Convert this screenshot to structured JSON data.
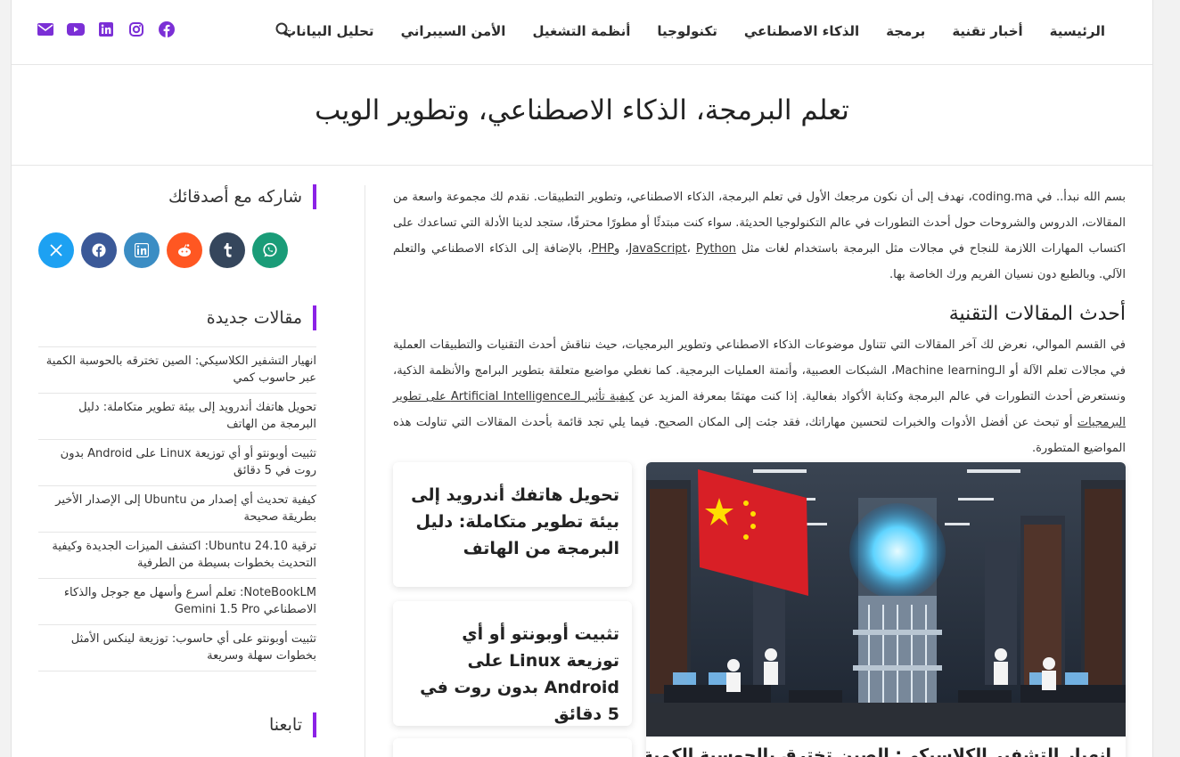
{
  "nav": {
    "items": [
      "الرئيسية",
      "أخبار تقنية",
      "برمجة",
      "الذكاء الاصطناعي",
      "تكنولوجيا",
      "أنظمة التشغيل",
      "الأمن السيبراني",
      "تحليل البيانات"
    ]
  },
  "social_icons": [
    "facebook-icon",
    "instagram-icon",
    "linkedin-icon",
    "youtube-icon",
    "mail-icon"
  ],
  "hero": {
    "title": "تعلم البرمجة، الذكاء الاصطناعي، وتطوير الويب"
  },
  "sidebar": {
    "share_title": "شاركه مع أصدقائك",
    "share_buttons": [
      {
        "name": "x",
        "color": "#1da1f2"
      },
      {
        "name": "facebook",
        "color": "#3b5998"
      },
      {
        "name": "linkedin",
        "color": "#3b8dc4"
      },
      {
        "name": "reddit",
        "color": "#ff5722"
      },
      {
        "name": "tumblr",
        "color": "#35465c"
      },
      {
        "name": "whatsapp",
        "color": "#1a9c78"
      }
    ],
    "recent_title": "مقالات جديدة",
    "recent_posts": [
      "انهيار التشفير الكلاسيكي: الصين تخترقه بالحوسبة الكمية عبر حاسوب كمي",
      "تحويل هاتفك أندرويد إلى بيئة تطوير متكاملة: دليل البرمجة من الهاتف",
      "تثبيت أوبونتو أو أي توزيعة Linux على Android بدون روت في 5 دقائق",
      "كيفية تحديث أي إصدار من Ubuntu إلى الإصدار الأخير بطريقة صحيحة",
      "ترقية Ubuntu 24.10: اكتشف الميزات الجديدة وكيفية التحديث بخطوات بسيطة من الطرفية",
      "NoteBookLM: تعلم أسرع وأسهل مع جوجل والذكاء الاصطناعي Gemini 1.5 Pro",
      "تثبيت أوبونتو على أي حاسوب: توزيعة لينكس الأمثل بخطوات سهلة وسريعة"
    ],
    "follow_title": "تابعنا"
  },
  "main": {
    "intro_1": "بسم الله نبدأ.. في coding.ma، نهدف إلى أن نكون مرجعك الأول في تعلم البرمجة، الذكاء الاصطناعي، وتطوير التطبيقات. نقدم لك مجموعة واسعة من المقالات، الدروس والشروحات حول أحدث التطورات في عالم التكنولوجيا الحديثة. سواء كنت مبتدئًا أو مطورًا محترفًا، ستجد لدينا الأدلة التي تساعدك على اكتساب المهارات اللازمة للنجاح في مجالات مثل البرمجة باستخدام لغات مثل ",
    "lang_js": "JavaScript",
    "sep_1": "، ",
    "lang_py": "Python",
    "sep_2": "، و",
    "lang_php": "PHP",
    "intro_2": "، بالإضافة إلى الذكاء الاصطناعي والتعلم الآلي. وبالطبع دون نسيان الفريم ورك الخاصة بها.",
    "section_title": "أحدث المقالات التقنية",
    "body_1": "في القسم الموالي، نعرض لك آخر المقالات التي تتناول موضوعات الذكاء الاصطناعي وتطوير البرمجيات، حيث نناقش أحدث التقنيات والتطبيقات العملية في مجالات تعلم الآلة أو الـMachine learning، الشبكات العصبية، وأتمتة العمليات البرمجية. كما نغطي مواضيع متعلقة بتطوير البرامج والأنظمة الذكية، ونستعرض أحدث التطورات في عالم البرمجة وكتابة الأكواد بفعالية. إذا كنت مهتمًا بمعرفة المزيد عن ",
    "body_link": "كيفية تأثير الـArtificial Intelligence على تطوير البرمجيات",
    "body_2": " أو تبحث عن أفضل الأدوات والخبرات لتحسين مهاراتك، فقد جئت إلى المكان الصحيح. فيما يلي تجد قائمة بأحدث المقالات التي تناولت هذه المواضيع المتطورة."
  },
  "cards": {
    "featured_title": "انهيار التشفير الكلاسيكي: الصين تخترق بالحوسبة الكمية عبر",
    "small": [
      "تحويل هاتفك أندرويد إلى بيئة تطوير متكاملة: دليل البرمجة من الهاتف",
      "تثبيت أوبونتو أو أي توزيعة Linux على Android بدون روت في 5 دقائق"
    ]
  },
  "colors": {
    "accent": "#8c22e6",
    "social": "#7b2fd6"
  }
}
